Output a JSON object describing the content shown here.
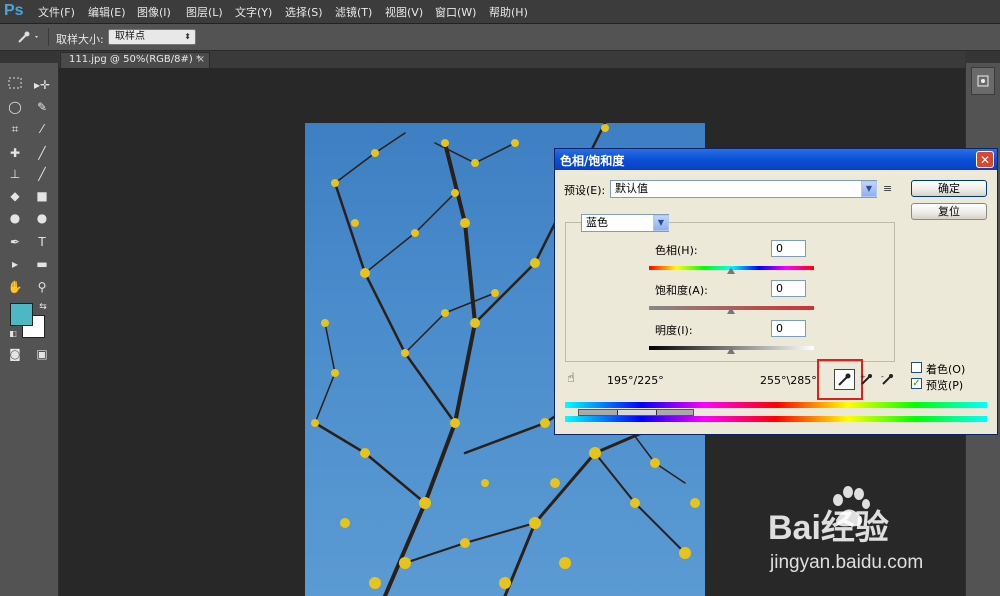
{
  "app": {
    "logo": "Ps"
  },
  "menu": [
    "文件(F)",
    "编辑(E)",
    "图像(I)",
    "图层(L)",
    "文字(Y)",
    "选择(S)",
    "滤镜(T)",
    "视图(V)",
    "窗口(W)",
    "帮助(H)"
  ],
  "options": {
    "sample_size_label": "取样大小:",
    "sample_size_value": "取样点"
  },
  "document": {
    "tab_title": "111.jpg @ 50%(RGB/8#) *",
    "close": "×"
  },
  "dialog": {
    "title": "色相/饱和度",
    "close": "✕",
    "preset_label": "预设(E):",
    "preset_value": "默认值",
    "ok": "确定",
    "reset": "复位",
    "channel": "蓝色",
    "hue_label": "色相(H):",
    "hue_value": "0",
    "saturation_label": "饱和度(A):",
    "saturation_value": "0",
    "lightness_label": "明度(I):",
    "lightness_value": "0",
    "range_left": "195°/225°",
    "range_right": "255°\\285°",
    "colorize_label": "着色(O)",
    "preview_label": "预览(P)",
    "preview_checked": "✓"
  },
  "watermark": {
    "text": "Bai经验",
    "url": "jingyan.baidu.com"
  },
  "colors": {
    "foreground": "#4cb8c4",
    "background": "#ffffff",
    "dialog_title": "#0a50d8",
    "highlight": "#e02020"
  }
}
